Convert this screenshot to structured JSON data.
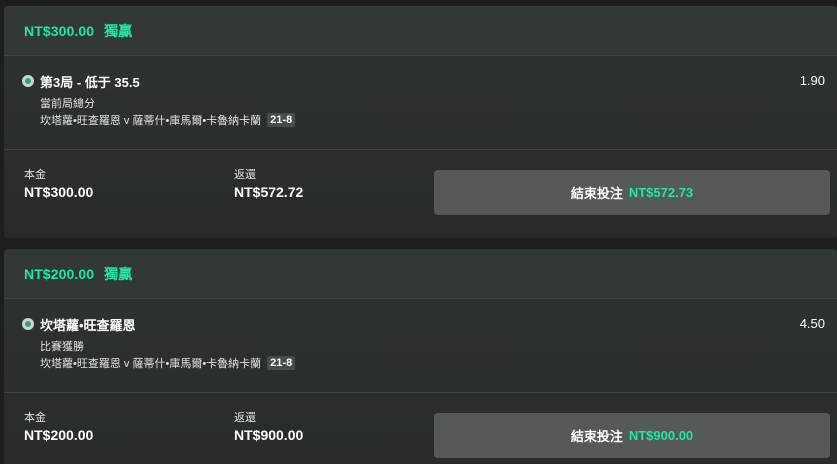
{
  "bets": [
    {
      "header_amount": "NT$300.00",
      "header_type": "獨贏",
      "selection": {
        "title": "第3局 - 低于 35.5",
        "odds": "1.90",
        "market": "當前局總分",
        "event": "坎塔蘿•旺查羅恩 v 薩蒂什•庫馬爾•卡魯納卡蘭",
        "score": "21-8"
      },
      "stake_label": "本金",
      "stake_value": "NT$300.00",
      "return_label": "返還",
      "return_value": "NT$572.72",
      "cashout_label": "結束投注",
      "cashout_amount": "NT$572.73"
    },
    {
      "header_amount": "NT$200.00",
      "header_type": "獨贏",
      "selection": {
        "title": "坎塔蘿•旺查羅恩",
        "odds": "4.50",
        "market": "比賽獲勝",
        "event": "坎塔蘿•旺查羅恩 v 薩蒂什•庫馬爾•卡魯納卡蘭",
        "score": "21-8"
      },
      "stake_label": "本金",
      "stake_value": "NT$200.00",
      "return_label": "返還",
      "return_value": "NT$900.00",
      "cashout_label": "結束投注",
      "cashout_amount": "NT$900.00"
    }
  ],
  "colors": {
    "accent": "#1de9a3",
    "card_bg": "#2f3533",
    "button_bg": "#555958"
  },
  "icons": {
    "selection": "badminton-shuttlecock-icon"
  }
}
